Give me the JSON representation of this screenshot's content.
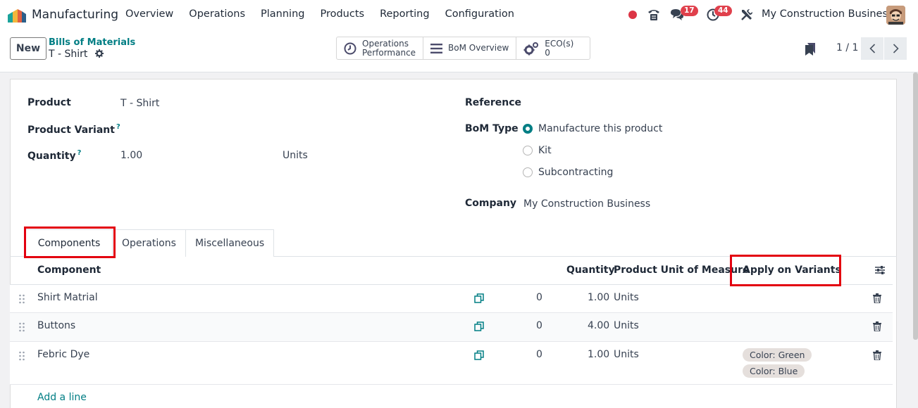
{
  "nav": {
    "app_name": "Manufacturing",
    "menu": [
      "Overview",
      "Operations",
      "Planning",
      "Products",
      "Reporting",
      "Configuration"
    ],
    "chat_count": "17",
    "activity_count": "44",
    "company": "My Construction Business"
  },
  "control": {
    "new_label": "New",
    "breadcrumb": "Bills of Materials",
    "record_title": "T - Shirt",
    "smart_buttons": {
      "ops_line1": "Operations",
      "ops_line2": "Performance",
      "bom_overview": "BoM Overview",
      "eco_label": "ECO(s)",
      "eco_count": "0"
    },
    "pager": "1 / 1"
  },
  "form": {
    "product_label": "Product",
    "product_value": "T - Shirt",
    "variant_label": "Product Variant",
    "quantity_label": "Quantity",
    "quantity_value": "1.00",
    "quantity_uom": "Units",
    "help_mark": "?",
    "reference_label": "Reference",
    "bom_type_label": "BoM Type",
    "bom_types": [
      "Manufacture this product",
      "Kit",
      "Subcontracting"
    ],
    "bom_type_selected": "Manufacture this product",
    "company_label": "Company",
    "company_value": "My Construction Business"
  },
  "tabs": [
    "Components",
    "Operations",
    "Miscellaneous"
  ],
  "table": {
    "headers": {
      "component": "Component",
      "quantity": "Quantity",
      "uom": "Product Unit of Measure",
      "variants": "Apply on Variants"
    },
    "rows": [
      {
        "component": "Shirt Matrial",
        "count": "0",
        "quantity": "1.00",
        "uom": "Units",
        "variants": []
      },
      {
        "component": "Buttons",
        "count": "0",
        "quantity": "4.00",
        "uom": "Units",
        "variants": []
      },
      {
        "component": "Febric Dye",
        "count": "0",
        "quantity": "1.00",
        "uom": "Units",
        "variants": [
          "Color: Green",
          "Color: Blue"
        ]
      }
    ],
    "add_line": "Add a line"
  },
  "colors": {
    "accent": "#017e84",
    "badge": "#e0404c",
    "highlight": "#e3000f"
  }
}
